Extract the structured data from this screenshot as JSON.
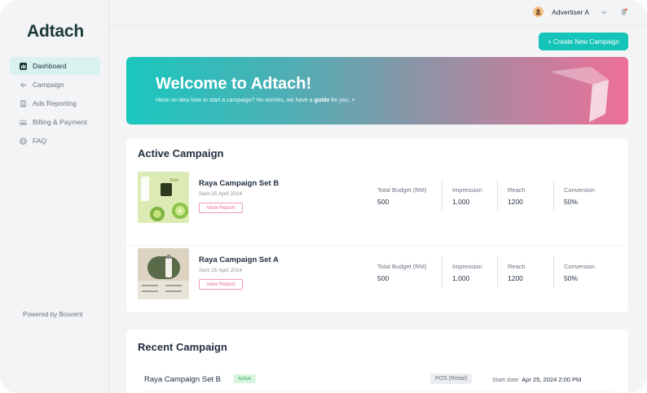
{
  "app": {
    "logo": "Adtach"
  },
  "sidebar": {
    "items": [
      {
        "label": "Dashboard",
        "icon": "dashboard-icon",
        "active": true
      },
      {
        "label": "Campaign",
        "icon": "megaphone-icon",
        "active": false
      },
      {
        "label": "Ads Reporting",
        "icon": "report-icon",
        "active": false
      },
      {
        "label": "Billing & Payment",
        "icon": "card-icon",
        "active": false
      },
      {
        "label": "FAQ",
        "icon": "question-icon",
        "active": false
      }
    ],
    "powered_by": "Powered by Bosvent"
  },
  "header": {
    "user_name": "Advertiser A"
  },
  "toolbar": {
    "create_label": "+ Create New Campaign"
  },
  "banner": {
    "title": "Welcome to Adtach!",
    "text_before": "Have no idea how to start a campaign? No worries, we have a",
    "link_word": "guide",
    "text_after": "for you.  >"
  },
  "active_campaign": {
    "title": "Active Campaign",
    "view_label": "View Report",
    "stat_labels": [
      "Total Budget (RM)",
      "Impression",
      "Reach",
      "Conversion"
    ],
    "rows": [
      {
        "name": "Raya Campaign Set B",
        "sent": "Sent 25 April 2024",
        "budget": "500",
        "impression": "1,000",
        "reach": "1200",
        "conversion": "50%"
      },
      {
        "name": "Raya Campaign Set A",
        "sent": "Sent 25 April 2024",
        "budget": "500",
        "impression": "1,000",
        "reach": "1200",
        "conversion": "50%"
      }
    ]
  },
  "recent_campaign": {
    "title": "Recent Campaign",
    "rows": [
      {
        "name": "Raya Campaign Set B",
        "status": "Active",
        "channel": "POS (Retail)",
        "start_label": "Start date",
        "start_value": "Apr 25, 2024   2:00 PM"
      }
    ]
  },
  "colors": {
    "accent": "#15c4b8",
    "pink": "#ee6f98",
    "active_nav": "#d9f1ef"
  }
}
